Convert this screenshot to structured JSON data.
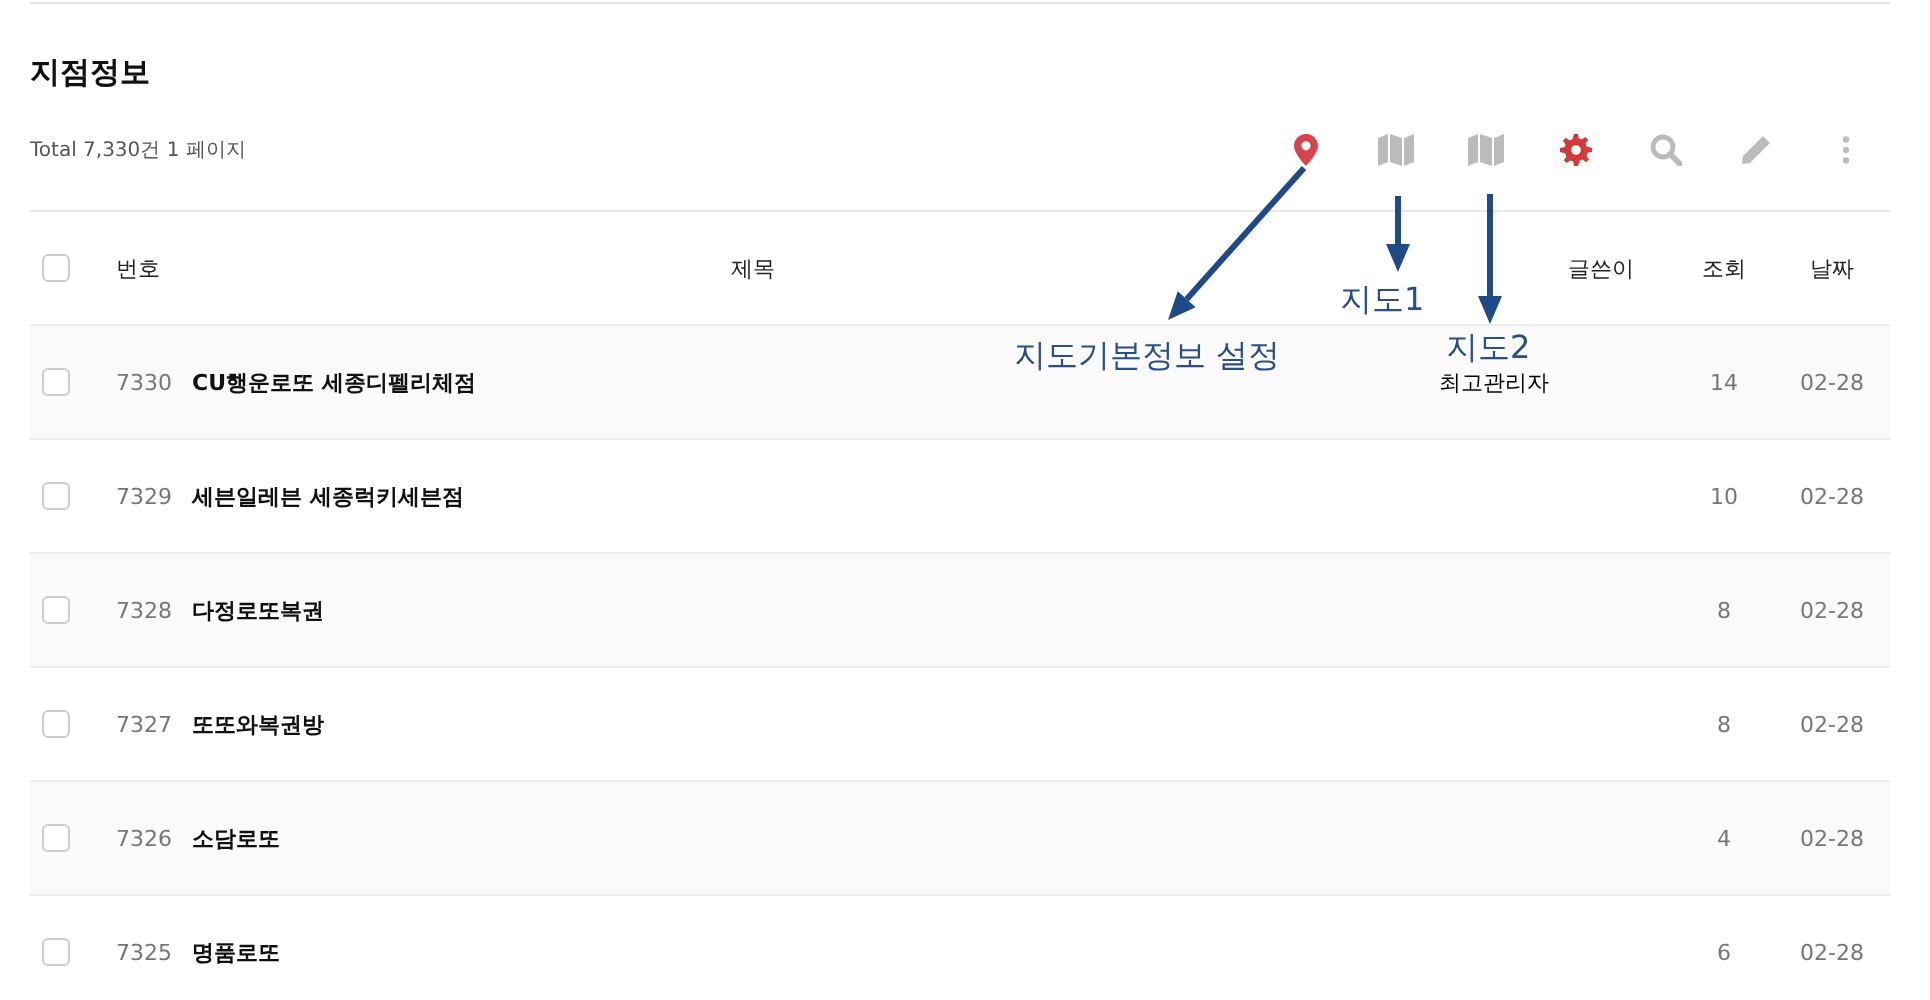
{
  "title": "지점정보",
  "summary": "Total 7,330건 1 페이지",
  "toolbar": [
    {
      "kind": "pin",
      "color": "#d9434b"
    },
    {
      "kind": "map",
      "color": "#bbbbbb"
    },
    {
      "kind": "map",
      "color": "#bbbbbb"
    },
    {
      "kind": "gear",
      "color": "#d33a3a"
    },
    {
      "kind": "search",
      "color": "#bbbbbb"
    },
    {
      "kind": "pencil",
      "color": "#bbbbbb"
    },
    {
      "kind": "more",
      "color": "#bbbbbb"
    }
  ],
  "table": {
    "header_checked": false,
    "columns": [
      "번호",
      "제목",
      "글쓴이",
      "조회",
      "날짜"
    ],
    "rows": [
      {
        "checked": false,
        "number": "7330",
        "title": "CU행운로또 세종디펠리체점",
        "writer": "최고관리자",
        "views": "14",
        "date": "02-28"
      },
      {
        "checked": false,
        "number": "7329",
        "title": "세븐일레븐 세종럭키세븐점",
        "views": "10",
        "date": "02-28"
      },
      {
        "checked": false,
        "number": "7328",
        "title": "다정로또복권",
        "views": "8",
        "date": "02-28"
      },
      {
        "checked": false,
        "number": "7327",
        "title": "또또와복권방",
        "views": "8",
        "date": "02-28"
      },
      {
        "checked": false,
        "number": "7326",
        "title": "소담로또",
        "views": "4",
        "date": "02-28"
      },
      {
        "checked": false,
        "number": "7325",
        "title": "명품로또",
        "views": "6",
        "date": "02-28"
      }
    ]
  },
  "annotations": [
    {
      "label": "지도기본정보 설정"
    },
    {
      "label": "지도1"
    },
    {
      "label": "지도2"
    }
  ]
}
